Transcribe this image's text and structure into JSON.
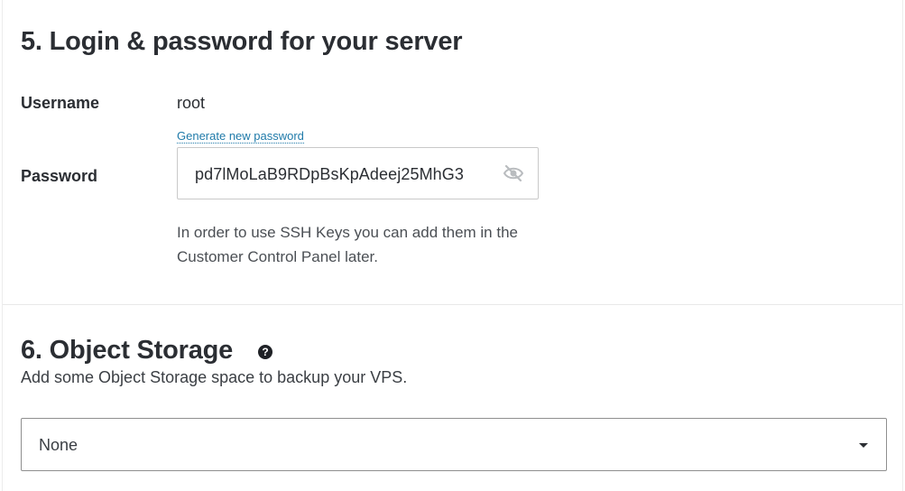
{
  "section5": {
    "title": "5. Login & password for your server",
    "username_label": "Username",
    "username_value": "root",
    "generate_link": "Generate new password",
    "password_label": "Password",
    "password_value": "pd7lMoLaB9RDpBsKpAdeej25MhG3",
    "password_visibility_icon": "eye-slash-icon",
    "ssh_hint": "In order to use SSH Keys you can add them in the Customer Control Panel later."
  },
  "section6": {
    "title": "6. Object Storage",
    "help_icon": "question-circle-icon",
    "help_glyph": "?",
    "subtitle": "Add some Object Storage space to backup your VPS.",
    "select_value": "None",
    "select_icon": "caret-down-icon"
  },
  "colors": {
    "text": "#2b2e33",
    "link": "#1f7aa9",
    "border": "#c9c9c9",
    "select_border": "#8f8f8f"
  }
}
